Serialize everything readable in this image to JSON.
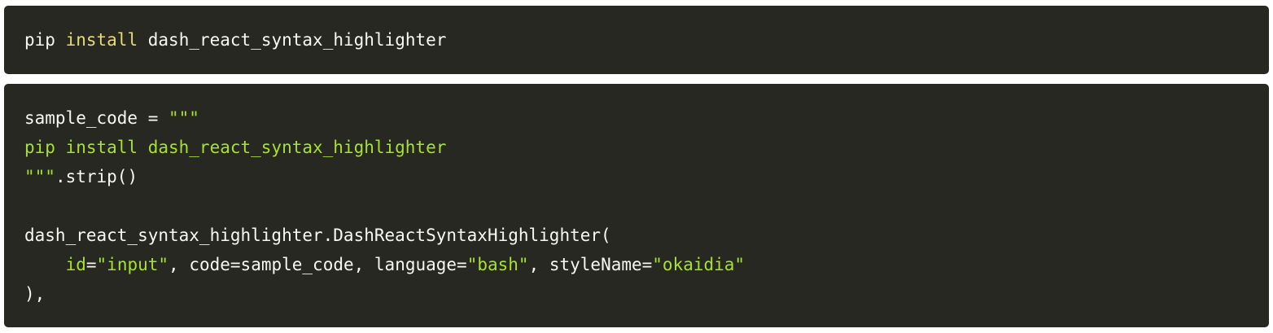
{
  "install_block": {
    "tokens": [
      "pip",
      " ",
      "install",
      " ",
      "dash_react_syntax_highlighter"
    ]
  },
  "example_block": {
    "line1": [
      "sample_code",
      " = ",
      "\"\"\""
    ],
    "line2": [
      "pip install dash_react_syntax_highlighter"
    ],
    "line3": [
      "\"\"\"",
      ".strip()"
    ],
    "line5": [
      "dash_react_syntax_highlighter.DashReactSyntaxHighlighter("
    ],
    "line6": [
      "    ",
      "id",
      "=",
      "\"input\"",
      ", code=sample_code, language=",
      "\"bash\"",
      ", styleName=",
      "\"okaidia\""
    ],
    "line7": [
      "),"
    ]
  },
  "colors": {
    "background": "#272822",
    "text": "#f8f8f2",
    "keyword": "#e6db74",
    "string": "#a6e22e"
  }
}
